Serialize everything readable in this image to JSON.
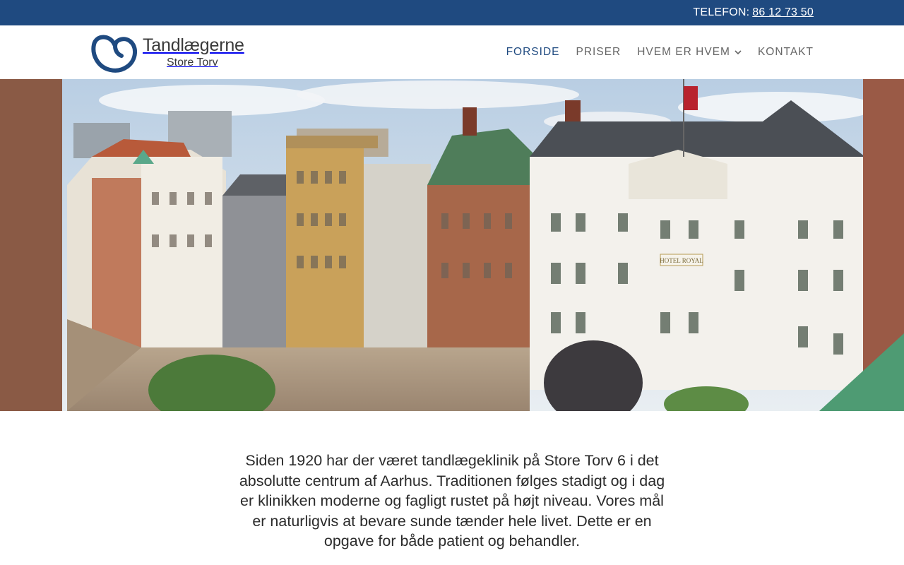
{
  "topbar": {
    "phone_label": "TELEFON:",
    "phone_number": "86 12 73 50"
  },
  "logo": {
    "title": "Tandlægerne",
    "subtitle": "Store Torv"
  },
  "nav": {
    "items": [
      {
        "label": "FORSIDE"
      },
      {
        "label": "PRISER"
      },
      {
        "label": "HVEM ER HVEM"
      },
      {
        "label": "KONTAKT"
      }
    ]
  },
  "hero": {
    "building_sign": "HOTEL ROYAL"
  },
  "intro": {
    "text": "Siden 1920 har der været tandlægeklinik på Store Torv 6 i det absolutte centrum af Aarhus. Traditionen følges stadigt og i dag er klinikken moderne og fagligt rustet på højt niveau. Vores mål er naturligvis at bevare sunde tænder hele livet. Dette er en opgave for både patient og behandler."
  },
  "colors": {
    "brand_blue": "#1f4a80",
    "nav_text": "#666666",
    "body_text": "#2b2b2b"
  }
}
